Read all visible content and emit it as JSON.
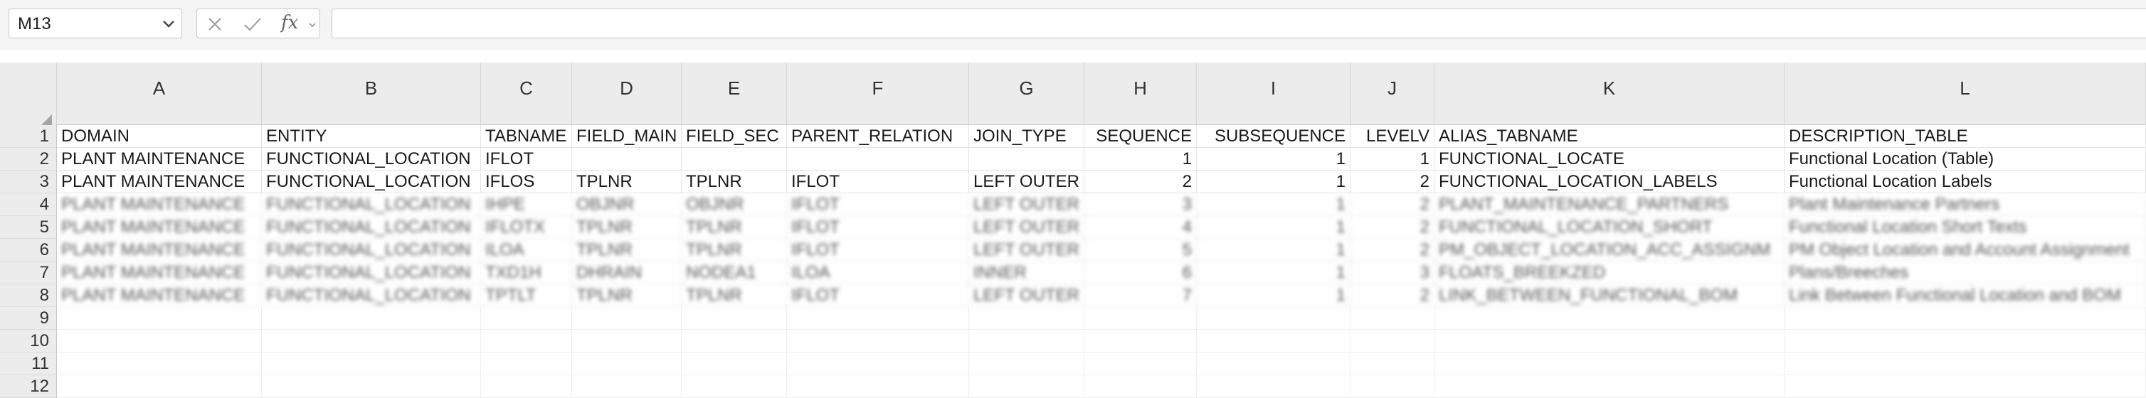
{
  "formula_bar": {
    "name_box": "M13",
    "fx": "fx",
    "formula": ""
  },
  "icons": {
    "name_box_dropdown": "chevron-down-icon",
    "cancel": "close-icon",
    "confirm": "check-icon",
    "function": "fx-icon"
  },
  "columns": [
    "A",
    "B",
    "C",
    "D",
    "E",
    "F",
    "G",
    "H",
    "I",
    "J",
    "K",
    "L"
  ],
  "row_numbers": [
    "1",
    "2",
    "3",
    "4",
    "5",
    "6",
    "7",
    "8",
    "9",
    "10",
    "11",
    "12"
  ],
  "rows": [
    [
      "DOMAIN",
      "ENTITY",
      "TABNAME",
      "FIELD_MAIN",
      "FIELD_SEC",
      "PARENT_RELATION",
      "JOIN_TYPE",
      "SEQUENCE",
      "SUBSEQUENCE",
      "LEVELV",
      "ALIAS_TABNAME",
      "DESCRIPTION_TABLE"
    ],
    [
      "PLANT MAINTENANCE",
      "FUNCTIONAL_LOCATION",
      "IFLOT",
      "",
      "",
      "",
      "",
      "1",
      "1",
      "1",
      "FUNCTIONAL_LOCATE",
      "Functional Location (Table)"
    ],
    [
      "PLANT MAINTENANCE",
      "FUNCTIONAL_LOCATION",
      "IFLOS",
      "TPLNR",
      "TPLNR",
      "IFLOT",
      "LEFT OUTER",
      "2",
      "1",
      "2",
      "FUNCTIONAL_LOCATION_LABELS",
      "Functional Location Labels"
    ],
    [
      "PLANT MAINTENANCE",
      "FUNCTIONAL_LOCATION",
      "IHPE",
      "OBJNR",
      "OBJNR",
      "IFLOT",
      "LEFT OUTER",
      "3",
      "1",
      "2",
      "PLANT_MAINTENANCE_PARTNERS",
      "Plant Maintenance Partners"
    ],
    [
      "PLANT MAINTENANCE",
      "FUNCTIONAL_LOCATION",
      "IFLOTX",
      "TPLNR",
      "TPLNR",
      "IFLOT",
      "LEFT OUTER",
      "4",
      "1",
      "2",
      "FUNCTIONAL_LOCATION_SHORT",
      "Functional Location Short Texts"
    ],
    [
      "PLANT MAINTENANCE",
      "FUNCTIONAL_LOCATION",
      "ILOA",
      "TPLNR",
      "TPLNR",
      "IFLOT",
      "LEFT OUTER",
      "5",
      "1",
      "2",
      "PM_OBJECT_LOCATION_ACC_ASSIGNM",
      "PM Object Location and Account Assignment"
    ],
    [
      "PLANT MAINTENANCE",
      "FUNCTIONAL_LOCATION",
      "TXD1H",
      "DHRAIN",
      "NODEA1",
      "ILOA",
      "INNER",
      "6",
      "1",
      "3",
      "FLOATS_BREEKZED",
      "Plans/Breeches"
    ],
    [
      "PLANT MAINTENANCE",
      "FUNCTIONAL_LOCATION",
      "TPTLT",
      "TPLNR",
      "TPLNR",
      "IFLOT",
      "LEFT OUTER",
      "7",
      "1",
      "2",
      "LINK_BETWEEN_FUNCTIONAL_BOM",
      "Link Between Functional Location and BOM"
    ],
    [
      "",
      "",
      "",
      "",
      "",
      "",
      "",
      "",
      "",
      "",
      "",
      ""
    ],
    [
      "",
      "",
      "",
      "",
      "",
      "",
      "",
      "",
      "",
      "",
      "",
      ""
    ],
    [
      "",
      "",
      "",
      "",
      "",
      "",
      "",
      "",
      "",
      "",
      "",
      ""
    ],
    [
      "",
      "",
      "",
      "",
      "",
      "",
      "",
      "",
      "",
      "",
      "",
      ""
    ]
  ]
}
